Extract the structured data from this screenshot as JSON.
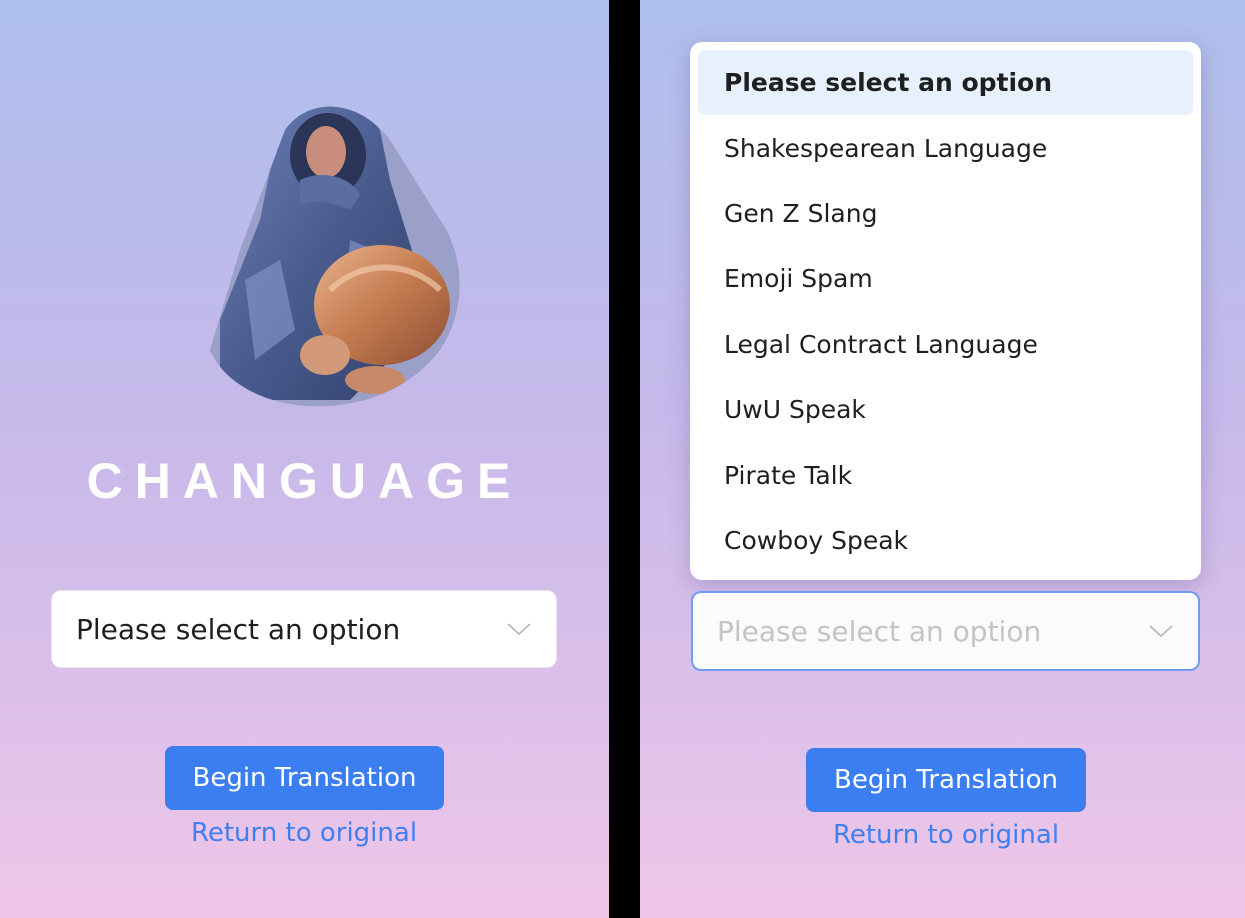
{
  "app": {
    "title": "CHANGUAGE"
  },
  "colors": {
    "accent": "#3b7ef2",
    "link": "#3f7ff0",
    "gradient_top": "#aebfec",
    "gradient_bottom": "#f0c6e8",
    "selected_option_bg": "#e6f1fd",
    "focus_border": "#6f9cf2"
  },
  "left_screen": {
    "select": {
      "value": "Please select an option",
      "icon": "chevron-down-icon"
    },
    "primary_button": "Begin Translation",
    "secondary_link": "Return to original"
  },
  "right_screen": {
    "dropdown": {
      "options": [
        "Please select an option",
        "Shakespearean Language",
        "Gen Z Slang",
        "Emoji Spam",
        "Legal Contract Language",
        "UwU Speak",
        "Pirate Talk",
        "Cowboy Speak"
      ],
      "selected_index": 0
    },
    "select": {
      "placeholder": "Please select an option",
      "icon": "chevron-down-icon"
    },
    "primary_button": "Begin Translation",
    "secondary_link": "Return to original"
  }
}
